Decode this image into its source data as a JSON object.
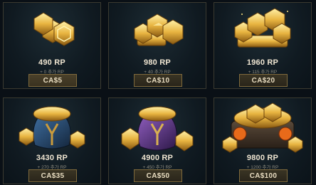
{
  "bundles": [
    {
      "amount": "490 RP",
      "bonus": "+ 0 추가 RP",
      "price": "CA$5",
      "art": "coin-stack-small-icon"
    },
    {
      "amount": "980 RP",
      "bonus": "+ 40 추가 RP",
      "price": "CA$10",
      "art": "coin-pile-icon"
    },
    {
      "amount": "1960 RP",
      "bonus": "+ 115 추가 RP",
      "price": "CA$20",
      "art": "coin-pile-large-icon"
    },
    {
      "amount": "3430 RP",
      "bonus": "+ 270 추가 RP",
      "price": "CA$35",
      "art": "blue-sack-icon"
    },
    {
      "amount": "4900 RP",
      "bonus": "+ 450 추가 RP",
      "price": "CA$50",
      "art": "purple-sack-icon"
    },
    {
      "amount": "9800 RP",
      "bonus": "+ 1200 추가 RP",
      "price": "CA$100",
      "art": "treasure-chest-icon"
    }
  ]
}
